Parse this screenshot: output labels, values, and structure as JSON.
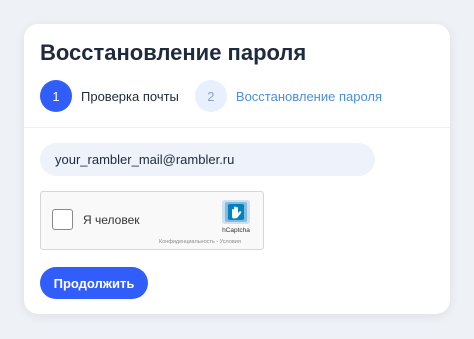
{
  "page": {
    "title": "Восстановление пароля"
  },
  "steps": [
    {
      "number": "1",
      "label": "Проверка почты",
      "state": "active"
    },
    {
      "number": "2",
      "label": "Восстановление пароля",
      "state": "inactive"
    }
  ],
  "form": {
    "email_value": "your_rambler_mail@rambler.ru",
    "submit_label": "Продолжить"
  },
  "captcha": {
    "checkbox_label": "Я человек",
    "brand": "hCaptcha",
    "links": "Конфиденциальность - Условия",
    "checked": false,
    "icon": "hcaptcha-logo-icon"
  },
  "colors": {
    "accent": "#315efb",
    "step_inactive_bg": "#e8f0fd",
    "step_inactive_text": "#4a90d9",
    "input_bg": "#edf2fb",
    "page_bg": "#eef1f5"
  }
}
